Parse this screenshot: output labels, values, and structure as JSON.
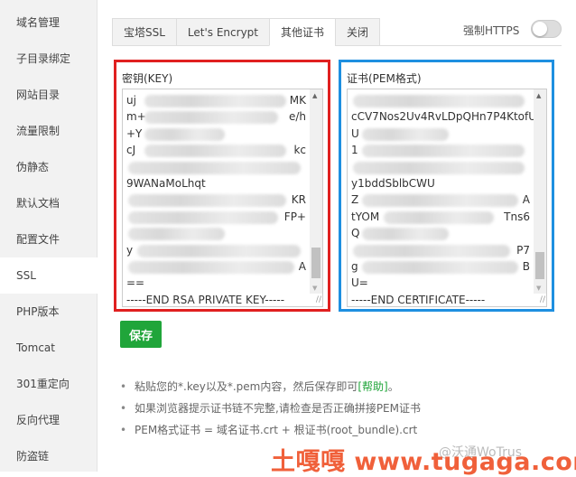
{
  "sidebar": {
    "items": [
      {
        "label": "域名管理"
      },
      {
        "label": "子目录绑定"
      },
      {
        "label": "网站目录"
      },
      {
        "label": "流量限制"
      },
      {
        "label": "伪静态"
      },
      {
        "label": "默认文档"
      },
      {
        "label": "配置文件"
      },
      {
        "label": "SSL",
        "active": true
      },
      {
        "label": "PHP版本"
      },
      {
        "label": "Tomcat"
      },
      {
        "label": "301重定向"
      },
      {
        "label": "反向代理"
      },
      {
        "label": "防盗链"
      }
    ]
  },
  "tabs": [
    {
      "label": "宝塔SSL"
    },
    {
      "label": "Let's Encrypt"
    },
    {
      "label": "其他证书",
      "active": true
    },
    {
      "label": "关闭"
    }
  ],
  "force_https": {
    "label": "强制HTTPS",
    "enabled": false
  },
  "key": {
    "label": "密钥(KEY)",
    "lines": [
      [
        "uj",
        "MK"
      ],
      [
        "m+",
        "e/h"
      ],
      [
        "+Y",
        ""
      ],
      [
        "cJ",
        "kc"
      ],
      [
        "",
        ""
      ],
      [
        "9WANaMoLhqt",
        ""
      ],
      [
        "",
        "KR"
      ],
      [
        "",
        "FP+"
      ],
      [
        "",
        ""
      ],
      [
        "y",
        ""
      ],
      [
        "",
        "A"
      ],
      [
        "==",
        ""
      ],
      [
        "-----END RSA PRIVATE KEY-----",
        ""
      ]
    ]
  },
  "cert": {
    "label": "证书(PEM格式)",
    "lines": [
      [
        "",
        ""
      ],
      [
        "cCV7Nos2Uv4RvLDpQHn7P4KtofU",
        ""
      ],
      [
        "U",
        ""
      ],
      [
        "1",
        ""
      ],
      [
        "",
        ""
      ],
      [
        "y1bddSblbCWU",
        ""
      ],
      [
        "Z",
        "A"
      ],
      [
        "tYOM",
        "Tns6"
      ],
      [
        "Q",
        ""
      ],
      [
        "",
        "P7"
      ],
      [
        "g",
        "B"
      ],
      [
        "U=",
        ""
      ],
      [
        "-----END CERTIFICATE-----",
        ""
      ]
    ]
  },
  "save_label": "保存",
  "tips": {
    "t1": "粘贴您的*.key以及*.pem内容，然后保存即可",
    "help": "[帮助]",
    "t1_end": "。",
    "t2": "如果浏览器提示证书链不完整,请检查是否正确拼接PEM证书",
    "t3": "PEM格式证书 = 域名证书.crt + 根证书(root_bundle).crt"
  },
  "watermark": {
    "site": "土嘎嘎 www.tugaga.com",
    "source": "@沃通WoTrus"
  },
  "colors": {
    "save": "#20a53a",
    "key_highlight": "#e02020",
    "cert_highlight": "#1e8fe0"
  }
}
